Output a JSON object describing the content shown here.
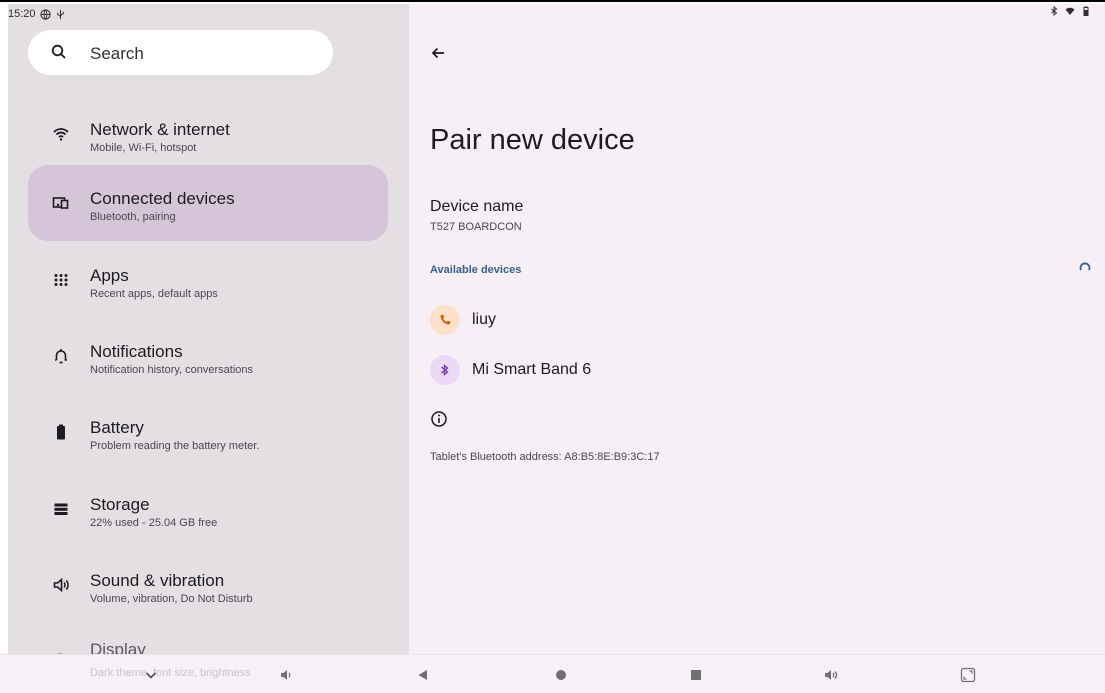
{
  "status": {
    "time": "15:20"
  },
  "search": {
    "placeholder": "Search"
  },
  "sidebar": {
    "items": [
      {
        "title": "Network & internet",
        "subtitle": "Mobile, Wi-Fi, hotspot",
        "icon": "wifi-icon"
      },
      {
        "title": "Connected devices",
        "subtitle": "Bluetooth, pairing",
        "icon": "devices-icon",
        "active": true
      },
      {
        "title": "Apps",
        "subtitle": "Recent apps, default apps",
        "icon": "apps-grid-icon"
      },
      {
        "title": "Notifications",
        "subtitle": "Notification history, conversations",
        "icon": "bell-icon"
      },
      {
        "title": "Battery",
        "subtitle": "Problem reading the battery meter.",
        "icon": "battery-icon"
      },
      {
        "title": "Storage",
        "subtitle": "22% used - 25.04 GB free",
        "icon": "storage-icon"
      },
      {
        "title": "Sound & vibration",
        "subtitle": "Volume, vibration, Do Not Disturb",
        "icon": "volume-icon"
      },
      {
        "title": "Display",
        "subtitle": "Dark theme, font size, brightness",
        "icon": "brightness-icon"
      }
    ]
  },
  "detail": {
    "title": "Pair new device",
    "device_name_label": "Device name",
    "device_name_value": "T527 BOARDCON",
    "available_header": "Available devices",
    "devices": [
      {
        "name": "liuy",
        "icon": "phone-icon",
        "badge_color": "#fde0c8",
        "icon_color": "#c9620f"
      },
      {
        "name": "Mi Smart Band 6",
        "icon": "bluetooth-icon",
        "badge_color": "#ecd9f7",
        "icon_color": "#7a3fa6"
      }
    ],
    "bt_address": "Tablet's Bluetooth address: A8:B5:8E:B9:3C:17"
  },
  "colors": {
    "active_item": "#d6c5d9",
    "accent": "#3b5f8a"
  }
}
